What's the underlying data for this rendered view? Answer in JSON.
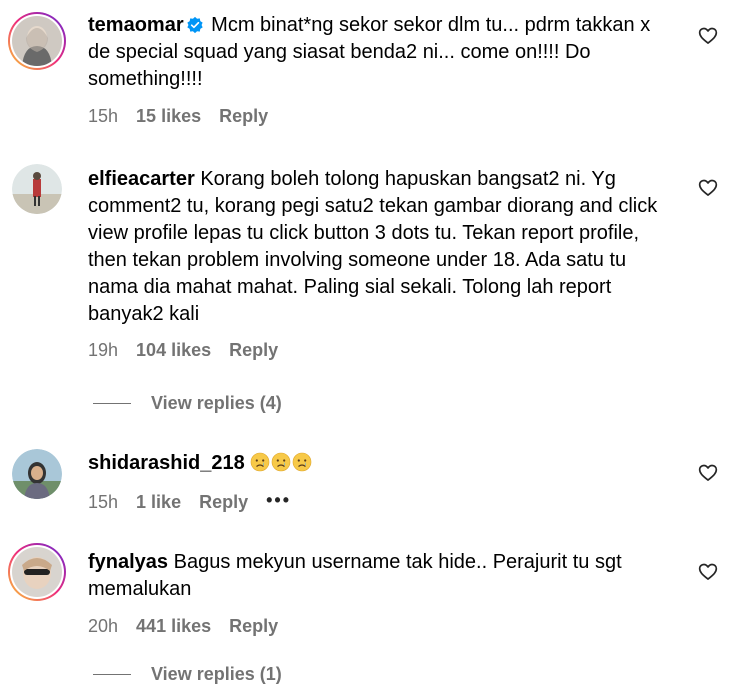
{
  "comments": [
    {
      "username": "temaomar",
      "verified": true,
      "text": "Mcm binat*ng sekor sekor dlm tu... pdrm takkan x de special squad yang siasat benda2 ni... come on!!!! Do something!!!!",
      "time": "15h",
      "likes": "15 likes",
      "reply": "Reply"
    },
    {
      "username": "elfieacarter",
      "verified": false,
      "text": "Korang boleh tolong hapuskan bangsat2 ni. Yg comment2 tu, korang pegi satu2 tekan gambar diorang and click view profile lepas tu click button 3 dots tu. Tekan report profile, then tekan problem involving someone under 18. Ada satu tu nama dia mahat mahat. Paling sial sekali. Tolong lah report banyak2 kali",
      "time": "19h",
      "likes": "104 likes",
      "reply": "Reply",
      "view_replies": "View replies (4)"
    },
    {
      "username": "shidarashid_218",
      "verified": false,
      "text": "",
      "emojis": [
        "crying-face-emoji",
        "crying-face-emoji",
        "crying-face-emoji"
      ],
      "time": "15h",
      "likes": "1 like",
      "reply": "Reply",
      "more": "•••"
    },
    {
      "username": "fynalyas",
      "verified": false,
      "text": "Bagus mekyun username tak hide.. Perajurit tu sgt memalukan",
      "time": "20h",
      "likes": "441 likes",
      "reply": "Reply",
      "view_replies": "View replies (1)"
    }
  ],
  "colors": {
    "meta": "#737373",
    "verified": "#0095f6",
    "story_ring_start": "#f9ce34",
    "story_ring_mid": "#ee2a7b",
    "story_ring_end": "#6228d7"
  }
}
